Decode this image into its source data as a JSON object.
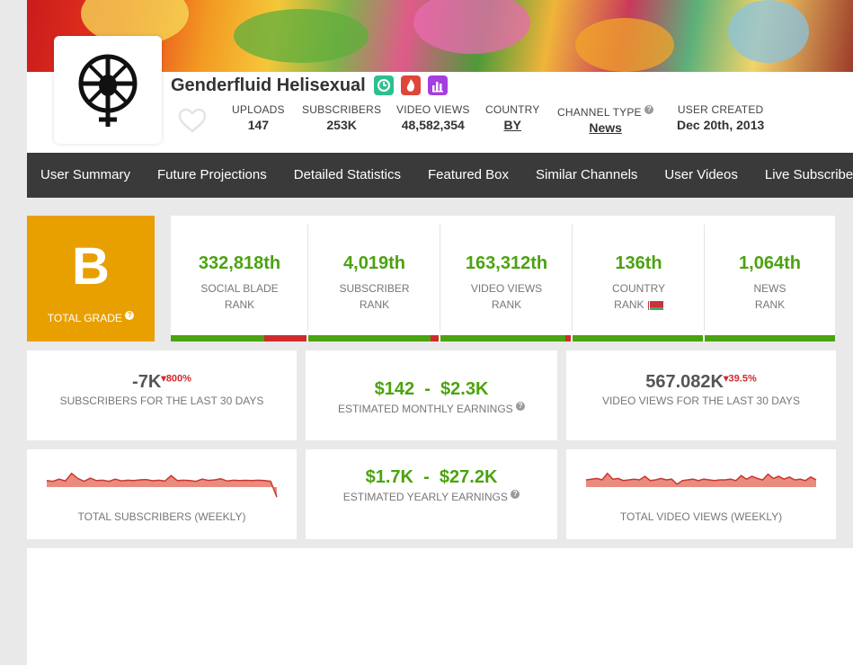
{
  "channel": {
    "name": "Genderfluid Helisexual",
    "uploads_label": "UPLOADS",
    "uploads": "147",
    "subscribers_label": "SUBSCRIBERS",
    "subscribers": "253K",
    "video_views_label": "VIDEO VIEWS",
    "video_views": "48,582,354",
    "country_label": "COUNTRY",
    "country": "BY",
    "channel_type_label": "CHANNEL TYPE",
    "channel_type": "News",
    "user_created_label": "USER CREATED",
    "user_created": "Dec 20th, 2013"
  },
  "badges": [
    {
      "icon": "clock-icon",
      "color": "#2ebf91"
    },
    {
      "icon": "flame-icon",
      "color": "#e0453a"
    },
    {
      "icon": "chart-icon",
      "color": "#a53ee0"
    }
  ],
  "nav": [
    "User Summary",
    "Future Projections",
    "Detailed Statistics",
    "Featured Box",
    "Similar Channels",
    "User Videos",
    "Live Subscriber Count"
  ],
  "grade": {
    "letter": "B",
    "label": "TOTAL GRADE"
  },
  "ranks": [
    {
      "value": "332,818th",
      "line1": "SOCIAL BLADE",
      "line2": "RANK",
      "green_fraction": 0.69
    },
    {
      "value": "4,019th",
      "line1": "SUBSCRIBER",
      "line2": "RANK",
      "green_fraction": 0.94
    },
    {
      "value": "163,312th",
      "line1": "VIDEO VIEWS",
      "line2": "RANK",
      "green_fraction": 0.96
    },
    {
      "value": "136th",
      "line1": "COUNTRY",
      "line2": "RANK",
      "green_fraction": 1.0
    },
    {
      "value": "1,064th",
      "line1": "NEWS",
      "line2": "RANK",
      "green_fraction": 1.0
    }
  ],
  "stats": {
    "subs_30": {
      "value": "-7K",
      "delta": "800%",
      "label": "SUBSCRIBERS FOR THE LAST 30 DAYS"
    },
    "monthly": {
      "low": "$142",
      "sep": "-",
      "high": "$2.3K",
      "label": "ESTIMATED MONTHLY EARNINGS"
    },
    "views_30": {
      "value": "567.082K",
      "delta": "39.5%",
      "label": "VIDEO VIEWS FOR THE LAST 30 DAYS"
    },
    "yearly": {
      "low": "$1.7K",
      "sep": "-",
      "high": "$27.2K",
      "label": "ESTIMATED YEARLY EARNINGS"
    },
    "subs_weekly_label": "TOTAL SUBSCRIBERS (WEEKLY)",
    "views_weekly_label": "TOTAL VIDEO VIEWS (WEEKLY)"
  },
  "chart_data": [
    {
      "type": "area",
      "title": "TOTAL SUBSCRIBERS (WEEKLY)",
      "values": [
        0.45,
        0.4,
        0.55,
        0.42,
        0.95,
        0.6,
        0.4,
        0.62,
        0.45,
        0.48,
        0.4,
        0.55,
        0.43,
        0.48,
        0.45,
        0.5,
        0.52,
        0.44,
        0.48,
        0.42,
        0.8,
        0.45,
        0.48,
        0.45,
        0.4,
        0.55,
        0.46,
        0.5,
        0.58,
        0.42,
        0.48,
        0.45,
        0.47,
        0.45,
        0.48,
        0.45,
        0.4,
        -0.7
      ]
    },
    {
      "type": "area",
      "title": "TOTAL VIDEO VIEWS (WEEKLY)",
      "values": [
        0.5,
        0.55,
        0.6,
        0.5,
        0.95,
        0.55,
        0.6,
        0.45,
        0.5,
        0.55,
        0.5,
        0.75,
        0.45,
        0.5,
        0.6,
        0.5,
        0.55,
        0.2,
        0.45,
        0.5,
        0.55,
        0.45,
        0.55,
        0.5,
        0.45,
        0.5,
        0.5,
        0.55,
        0.45,
        0.8,
        0.55,
        0.75,
        0.6,
        0.5,
        0.9,
        0.6,
        0.75,
        0.55,
        0.7,
        0.5,
        0.55,
        0.45,
        0.7,
        0.5
      ]
    }
  ]
}
